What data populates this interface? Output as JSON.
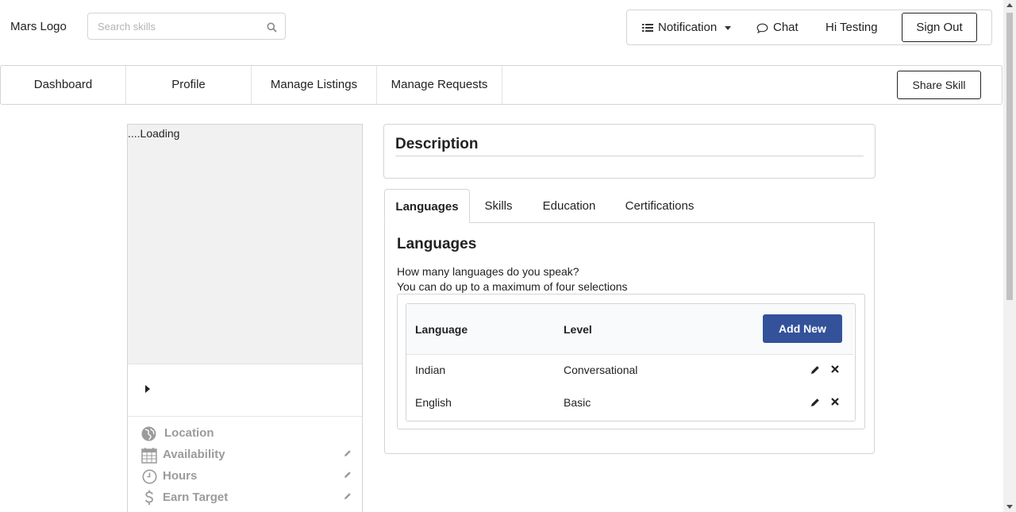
{
  "header": {
    "logo_text": "Mars Logo",
    "search_placeholder": "Search skills",
    "notification_label": "Notification",
    "chat_label": "Chat",
    "greeting": "Hi Testing",
    "sign_out_label": "Sign Out"
  },
  "nav": {
    "items": [
      "Dashboard",
      "Profile",
      "Manage Listings",
      "Manage Requests"
    ],
    "share_skill_label": "Share Skill"
  },
  "profile_card": {
    "image_alt": "....Loading",
    "info": [
      {
        "label": "Location",
        "icon": "globe-icon",
        "editable": false
      },
      {
        "label": "Availability",
        "icon": "calendar-icon",
        "editable": true
      },
      {
        "label": "Hours",
        "icon": "clock-icon",
        "editable": true
      },
      {
        "label": "Earn Target",
        "icon": "dollar-icon",
        "editable": true
      }
    ]
  },
  "description": {
    "title": "Description"
  },
  "tabs": {
    "items": [
      "Languages",
      "Skills",
      "Education",
      "Certifications"
    ],
    "active": "Languages"
  },
  "languages": {
    "title": "Languages",
    "question": "How many languages do you speak?",
    "hint": "You can do up to a maximum of four selections",
    "columns": [
      "Language",
      "Level"
    ],
    "add_new_label": "Add New",
    "rows": [
      {
        "language": "Indian",
        "level": "Conversational"
      },
      {
        "language": "English",
        "level": "Basic"
      }
    ]
  },
  "colors": {
    "primary_button": "#34529a",
    "muted_text": "#9b9b9b",
    "border": "#d4d4d5"
  }
}
